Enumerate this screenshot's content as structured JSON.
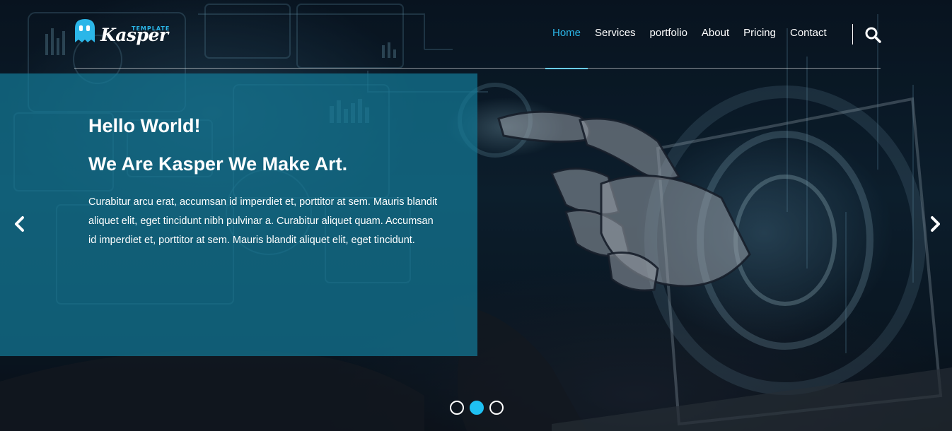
{
  "brand": {
    "logo_word": "Kasper",
    "logo_tag": "TEMPLATE",
    "logo_icon": "ghost-icon",
    "accent_color": "#2bb6e8"
  },
  "nav": {
    "items": [
      {
        "label": "Home",
        "active": true
      },
      {
        "label": "Services",
        "active": false
      },
      {
        "label": "portfolio",
        "active": false
      },
      {
        "label": "About",
        "active": false
      },
      {
        "label": "Pricing",
        "active": false
      },
      {
        "label": "Contact",
        "active": false
      }
    ],
    "search_icon": "search-icon"
  },
  "slider": {
    "title": "Hello World!",
    "subtitle": "We Are Kasper We Make Art.",
    "text": "Curabitur arcu erat, accumsan id imperdiet et, porttitor at sem. Mauris blandit aliquet elit, eget tincidunt nibh pulvinar a. Curabitur aliquet quam. Accumsan id imperdiet et, porttitor at sem. Mauris blandit aliquet elit, eget tincidunt.",
    "prev_icon": "chevron-left-icon",
    "next_icon": "chevron-right-icon",
    "slide_count": 3,
    "active_slide": 2,
    "box_color": "#13789a"
  }
}
